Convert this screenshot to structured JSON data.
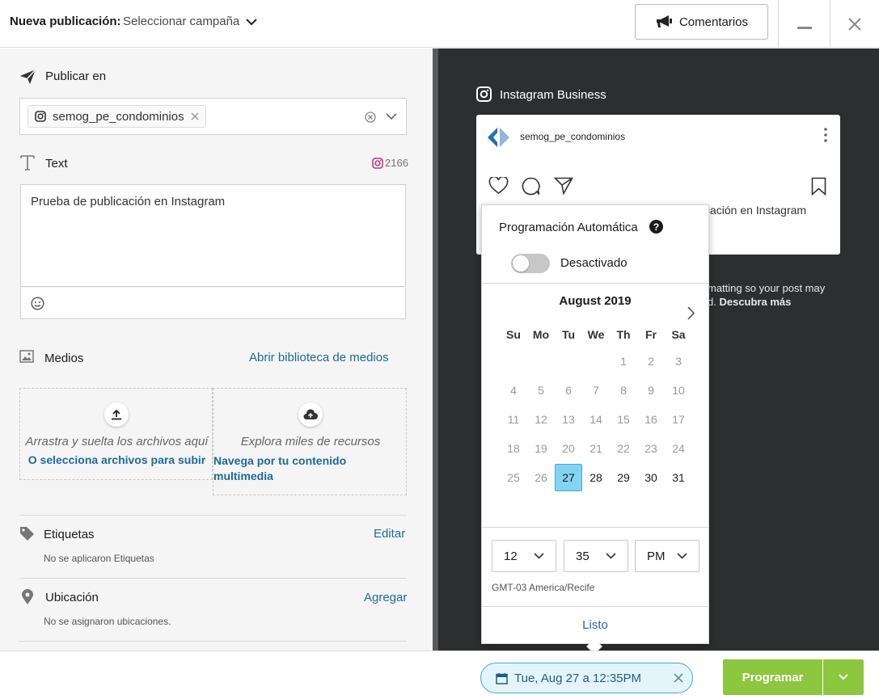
{
  "header": {
    "title": "Nueva publicación:",
    "campaign_select": "Seleccionar campaña",
    "comments_button": "Comentarios"
  },
  "publish": {
    "label": "Publicar en",
    "profile": "semog_pe_condominios"
  },
  "text": {
    "label": "Text",
    "char_count": "2166",
    "content": "Prueba de publicación en Instagram"
  },
  "media": {
    "label": "Medios",
    "open_library": "Abrir biblioteca de medios",
    "drop_text": "Arrastra y suelta los archivos aquí",
    "select_files": "O selecciona archivos para subir",
    "explore_text": "Explora miles de recursos",
    "browse_content": "Navega por tu contenido multimedia"
  },
  "tags": {
    "label": "Etiquetas",
    "action": "Editar",
    "empty": "No se aplicaron Etiquetas"
  },
  "location": {
    "label": "Ubicación",
    "action": "Agregar",
    "empty": "No se asignaron ubicaciones."
  },
  "preview": {
    "network": "Instagram Business",
    "account": "semog_pe_condominios",
    "caption_visible": "cación en Instagram",
    "note_line1": "matting so your post may",
    "note_line2_prefix": "d.",
    "note_link": "Descubra más"
  },
  "scheduler": {
    "auto_title": "Programación Automática",
    "toggle_label": "Desactivado",
    "toggle_on": false,
    "month": "August 2019",
    "weekdays": [
      "Su",
      "Mo",
      "Tu",
      "We",
      "Th",
      "Fr",
      "Sa"
    ],
    "weeks": [
      [
        "",
        "",
        "",
        "",
        "1",
        "2",
        "3"
      ],
      [
        "4",
        "5",
        "6",
        "7",
        "8",
        "9",
        "10"
      ],
      [
        "11",
        "12",
        "13",
        "14",
        "15",
        "16",
        "17"
      ],
      [
        "18",
        "19",
        "20",
        "21",
        "22",
        "23",
        "24"
      ],
      [
        "25",
        "26",
        "27",
        "28",
        "29",
        "30",
        "31"
      ]
    ],
    "selected_day": "27",
    "enabled_from": 27,
    "hour": "12",
    "minute": "35",
    "ampm": "PM",
    "timezone": "GMT-03 America/Recife",
    "done_button": "Listo"
  },
  "footer": {
    "date_chip": "Tue, Aug 27 a 12:35PM",
    "program_button": "Programar"
  },
  "colors": {
    "accent_green": "#8dc63f",
    "link_blue": "#1f6a9a",
    "selected_day": "#82d4f2",
    "preview_bg": "#2c2e2f"
  }
}
